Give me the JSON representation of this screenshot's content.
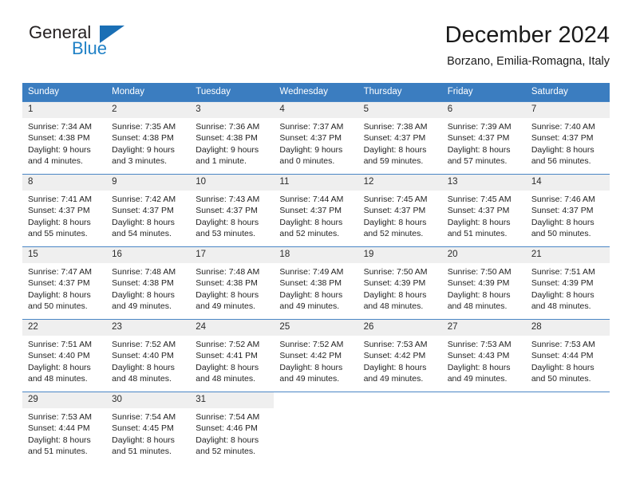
{
  "brand": {
    "name_top": "General",
    "name_bottom": "Blue",
    "triangle_icon": "triangle-logo-icon",
    "color_top": "#231f20",
    "color_bottom": "#2081c6",
    "triangle_color": "#1a6fb5"
  },
  "header": {
    "title": "December 2024",
    "subtitle": "Borzano, Emilia-Romagna, Italy"
  },
  "theme": {
    "header_bg": "#3b7dc0",
    "header_text": "#ffffff",
    "daynum_bg": "#efefef",
    "row_divider": "#4a86c5",
    "body_text": "#232323"
  },
  "weekdays": [
    "Sunday",
    "Monday",
    "Tuesday",
    "Wednesday",
    "Thursday",
    "Friday",
    "Saturday"
  ],
  "weeks": [
    [
      {
        "day": "1",
        "sunrise": "Sunrise: 7:34 AM",
        "sunset": "Sunset: 4:38 PM",
        "daylight_line1": "Daylight: 9 hours",
        "daylight_line2": "and 4 minutes."
      },
      {
        "day": "2",
        "sunrise": "Sunrise: 7:35 AM",
        "sunset": "Sunset: 4:38 PM",
        "daylight_line1": "Daylight: 9 hours",
        "daylight_line2": "and 3 minutes."
      },
      {
        "day": "3",
        "sunrise": "Sunrise: 7:36 AM",
        "sunset": "Sunset: 4:38 PM",
        "daylight_line1": "Daylight: 9 hours",
        "daylight_line2": "and 1 minute."
      },
      {
        "day": "4",
        "sunrise": "Sunrise: 7:37 AM",
        "sunset": "Sunset: 4:37 PM",
        "daylight_line1": "Daylight: 9 hours",
        "daylight_line2": "and 0 minutes."
      },
      {
        "day": "5",
        "sunrise": "Sunrise: 7:38 AM",
        "sunset": "Sunset: 4:37 PM",
        "daylight_line1": "Daylight: 8 hours",
        "daylight_line2": "and 59 minutes."
      },
      {
        "day": "6",
        "sunrise": "Sunrise: 7:39 AM",
        "sunset": "Sunset: 4:37 PM",
        "daylight_line1": "Daylight: 8 hours",
        "daylight_line2": "and 57 minutes."
      },
      {
        "day": "7",
        "sunrise": "Sunrise: 7:40 AM",
        "sunset": "Sunset: 4:37 PM",
        "daylight_line1": "Daylight: 8 hours",
        "daylight_line2": "and 56 minutes."
      }
    ],
    [
      {
        "day": "8",
        "sunrise": "Sunrise: 7:41 AM",
        "sunset": "Sunset: 4:37 PM",
        "daylight_line1": "Daylight: 8 hours",
        "daylight_line2": "and 55 minutes."
      },
      {
        "day": "9",
        "sunrise": "Sunrise: 7:42 AM",
        "sunset": "Sunset: 4:37 PM",
        "daylight_line1": "Daylight: 8 hours",
        "daylight_line2": "and 54 minutes."
      },
      {
        "day": "10",
        "sunrise": "Sunrise: 7:43 AM",
        "sunset": "Sunset: 4:37 PM",
        "daylight_line1": "Daylight: 8 hours",
        "daylight_line2": "and 53 minutes."
      },
      {
        "day": "11",
        "sunrise": "Sunrise: 7:44 AM",
        "sunset": "Sunset: 4:37 PM",
        "daylight_line1": "Daylight: 8 hours",
        "daylight_line2": "and 52 minutes."
      },
      {
        "day": "12",
        "sunrise": "Sunrise: 7:45 AM",
        "sunset": "Sunset: 4:37 PM",
        "daylight_line1": "Daylight: 8 hours",
        "daylight_line2": "and 52 minutes."
      },
      {
        "day": "13",
        "sunrise": "Sunrise: 7:45 AM",
        "sunset": "Sunset: 4:37 PM",
        "daylight_line1": "Daylight: 8 hours",
        "daylight_line2": "and 51 minutes."
      },
      {
        "day": "14",
        "sunrise": "Sunrise: 7:46 AM",
        "sunset": "Sunset: 4:37 PM",
        "daylight_line1": "Daylight: 8 hours",
        "daylight_line2": "and 50 minutes."
      }
    ],
    [
      {
        "day": "15",
        "sunrise": "Sunrise: 7:47 AM",
        "sunset": "Sunset: 4:37 PM",
        "daylight_line1": "Daylight: 8 hours",
        "daylight_line2": "and 50 minutes."
      },
      {
        "day": "16",
        "sunrise": "Sunrise: 7:48 AM",
        "sunset": "Sunset: 4:38 PM",
        "daylight_line1": "Daylight: 8 hours",
        "daylight_line2": "and 49 minutes."
      },
      {
        "day": "17",
        "sunrise": "Sunrise: 7:48 AM",
        "sunset": "Sunset: 4:38 PM",
        "daylight_line1": "Daylight: 8 hours",
        "daylight_line2": "and 49 minutes."
      },
      {
        "day": "18",
        "sunrise": "Sunrise: 7:49 AM",
        "sunset": "Sunset: 4:38 PM",
        "daylight_line1": "Daylight: 8 hours",
        "daylight_line2": "and 49 minutes."
      },
      {
        "day": "19",
        "sunrise": "Sunrise: 7:50 AM",
        "sunset": "Sunset: 4:39 PM",
        "daylight_line1": "Daylight: 8 hours",
        "daylight_line2": "and 48 minutes."
      },
      {
        "day": "20",
        "sunrise": "Sunrise: 7:50 AM",
        "sunset": "Sunset: 4:39 PM",
        "daylight_line1": "Daylight: 8 hours",
        "daylight_line2": "and 48 minutes."
      },
      {
        "day": "21",
        "sunrise": "Sunrise: 7:51 AM",
        "sunset": "Sunset: 4:39 PM",
        "daylight_line1": "Daylight: 8 hours",
        "daylight_line2": "and 48 minutes."
      }
    ],
    [
      {
        "day": "22",
        "sunrise": "Sunrise: 7:51 AM",
        "sunset": "Sunset: 4:40 PM",
        "daylight_line1": "Daylight: 8 hours",
        "daylight_line2": "and 48 minutes."
      },
      {
        "day": "23",
        "sunrise": "Sunrise: 7:52 AM",
        "sunset": "Sunset: 4:40 PM",
        "daylight_line1": "Daylight: 8 hours",
        "daylight_line2": "and 48 minutes."
      },
      {
        "day": "24",
        "sunrise": "Sunrise: 7:52 AM",
        "sunset": "Sunset: 4:41 PM",
        "daylight_line1": "Daylight: 8 hours",
        "daylight_line2": "and 48 minutes."
      },
      {
        "day": "25",
        "sunrise": "Sunrise: 7:52 AM",
        "sunset": "Sunset: 4:42 PM",
        "daylight_line1": "Daylight: 8 hours",
        "daylight_line2": "and 49 minutes."
      },
      {
        "day": "26",
        "sunrise": "Sunrise: 7:53 AM",
        "sunset": "Sunset: 4:42 PM",
        "daylight_line1": "Daylight: 8 hours",
        "daylight_line2": "and 49 minutes."
      },
      {
        "day": "27",
        "sunrise": "Sunrise: 7:53 AM",
        "sunset": "Sunset: 4:43 PM",
        "daylight_line1": "Daylight: 8 hours",
        "daylight_line2": "and 49 minutes."
      },
      {
        "day": "28",
        "sunrise": "Sunrise: 7:53 AM",
        "sunset": "Sunset: 4:44 PM",
        "daylight_line1": "Daylight: 8 hours",
        "daylight_line2": "and 50 minutes."
      }
    ],
    [
      {
        "day": "29",
        "sunrise": "Sunrise: 7:53 AM",
        "sunset": "Sunset: 4:44 PM",
        "daylight_line1": "Daylight: 8 hours",
        "daylight_line2": "and 51 minutes."
      },
      {
        "day": "30",
        "sunrise": "Sunrise: 7:54 AM",
        "sunset": "Sunset: 4:45 PM",
        "daylight_line1": "Daylight: 8 hours",
        "daylight_line2": "and 51 minutes."
      },
      {
        "day": "31",
        "sunrise": "Sunrise: 7:54 AM",
        "sunset": "Sunset: 4:46 PM",
        "daylight_line1": "Daylight: 8 hours",
        "daylight_line2": "and 52 minutes."
      },
      {
        "day": "",
        "sunrise": "",
        "sunset": "",
        "daylight_line1": "",
        "daylight_line2": ""
      },
      {
        "day": "",
        "sunrise": "",
        "sunset": "",
        "daylight_line1": "",
        "daylight_line2": ""
      },
      {
        "day": "",
        "sunrise": "",
        "sunset": "",
        "daylight_line1": "",
        "daylight_line2": ""
      },
      {
        "day": "",
        "sunrise": "",
        "sunset": "",
        "daylight_line1": "",
        "daylight_line2": ""
      }
    ]
  ]
}
